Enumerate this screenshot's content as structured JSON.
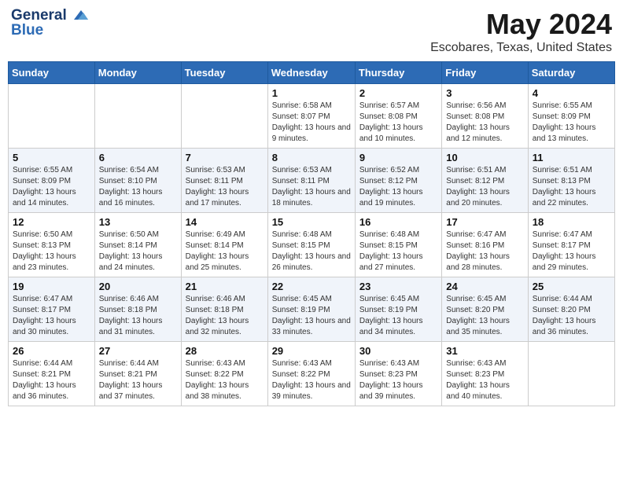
{
  "header": {
    "logo_line1": "General",
    "logo_line2": "Blue",
    "month": "May 2024",
    "location": "Escobares, Texas, United States"
  },
  "weekdays": [
    "Sunday",
    "Monday",
    "Tuesday",
    "Wednesday",
    "Thursday",
    "Friday",
    "Saturday"
  ],
  "weeks": [
    [
      {
        "day": "",
        "sunrise": "",
        "sunset": "",
        "daylight": ""
      },
      {
        "day": "",
        "sunrise": "",
        "sunset": "",
        "daylight": ""
      },
      {
        "day": "",
        "sunrise": "",
        "sunset": "",
        "daylight": ""
      },
      {
        "day": "1",
        "sunrise": "Sunrise: 6:58 AM",
        "sunset": "Sunset: 8:07 PM",
        "daylight": "Daylight: 13 hours and 9 minutes."
      },
      {
        "day": "2",
        "sunrise": "Sunrise: 6:57 AM",
        "sunset": "Sunset: 8:08 PM",
        "daylight": "Daylight: 13 hours and 10 minutes."
      },
      {
        "day": "3",
        "sunrise": "Sunrise: 6:56 AM",
        "sunset": "Sunset: 8:08 PM",
        "daylight": "Daylight: 13 hours and 12 minutes."
      },
      {
        "day": "4",
        "sunrise": "Sunrise: 6:55 AM",
        "sunset": "Sunset: 8:09 PM",
        "daylight": "Daylight: 13 hours and 13 minutes."
      }
    ],
    [
      {
        "day": "5",
        "sunrise": "Sunrise: 6:55 AM",
        "sunset": "Sunset: 8:09 PM",
        "daylight": "Daylight: 13 hours and 14 minutes."
      },
      {
        "day": "6",
        "sunrise": "Sunrise: 6:54 AM",
        "sunset": "Sunset: 8:10 PM",
        "daylight": "Daylight: 13 hours and 16 minutes."
      },
      {
        "day": "7",
        "sunrise": "Sunrise: 6:53 AM",
        "sunset": "Sunset: 8:11 PM",
        "daylight": "Daylight: 13 hours and 17 minutes."
      },
      {
        "day": "8",
        "sunrise": "Sunrise: 6:53 AM",
        "sunset": "Sunset: 8:11 PM",
        "daylight": "Daylight: 13 hours and 18 minutes."
      },
      {
        "day": "9",
        "sunrise": "Sunrise: 6:52 AM",
        "sunset": "Sunset: 8:12 PM",
        "daylight": "Daylight: 13 hours and 19 minutes."
      },
      {
        "day": "10",
        "sunrise": "Sunrise: 6:51 AM",
        "sunset": "Sunset: 8:12 PM",
        "daylight": "Daylight: 13 hours and 20 minutes."
      },
      {
        "day": "11",
        "sunrise": "Sunrise: 6:51 AM",
        "sunset": "Sunset: 8:13 PM",
        "daylight": "Daylight: 13 hours and 22 minutes."
      }
    ],
    [
      {
        "day": "12",
        "sunrise": "Sunrise: 6:50 AM",
        "sunset": "Sunset: 8:13 PM",
        "daylight": "Daylight: 13 hours and 23 minutes."
      },
      {
        "day": "13",
        "sunrise": "Sunrise: 6:50 AM",
        "sunset": "Sunset: 8:14 PM",
        "daylight": "Daylight: 13 hours and 24 minutes."
      },
      {
        "day": "14",
        "sunrise": "Sunrise: 6:49 AM",
        "sunset": "Sunset: 8:14 PM",
        "daylight": "Daylight: 13 hours and 25 minutes."
      },
      {
        "day": "15",
        "sunrise": "Sunrise: 6:48 AM",
        "sunset": "Sunset: 8:15 PM",
        "daylight": "Daylight: 13 hours and 26 minutes."
      },
      {
        "day": "16",
        "sunrise": "Sunrise: 6:48 AM",
        "sunset": "Sunset: 8:15 PM",
        "daylight": "Daylight: 13 hours and 27 minutes."
      },
      {
        "day": "17",
        "sunrise": "Sunrise: 6:47 AM",
        "sunset": "Sunset: 8:16 PM",
        "daylight": "Daylight: 13 hours and 28 minutes."
      },
      {
        "day": "18",
        "sunrise": "Sunrise: 6:47 AM",
        "sunset": "Sunset: 8:17 PM",
        "daylight": "Daylight: 13 hours and 29 minutes."
      }
    ],
    [
      {
        "day": "19",
        "sunrise": "Sunrise: 6:47 AM",
        "sunset": "Sunset: 8:17 PM",
        "daylight": "Daylight: 13 hours and 30 minutes."
      },
      {
        "day": "20",
        "sunrise": "Sunrise: 6:46 AM",
        "sunset": "Sunset: 8:18 PM",
        "daylight": "Daylight: 13 hours and 31 minutes."
      },
      {
        "day": "21",
        "sunrise": "Sunrise: 6:46 AM",
        "sunset": "Sunset: 8:18 PM",
        "daylight": "Daylight: 13 hours and 32 minutes."
      },
      {
        "day": "22",
        "sunrise": "Sunrise: 6:45 AM",
        "sunset": "Sunset: 8:19 PM",
        "daylight": "Daylight: 13 hours and 33 minutes."
      },
      {
        "day": "23",
        "sunrise": "Sunrise: 6:45 AM",
        "sunset": "Sunset: 8:19 PM",
        "daylight": "Daylight: 13 hours and 34 minutes."
      },
      {
        "day": "24",
        "sunrise": "Sunrise: 6:45 AM",
        "sunset": "Sunset: 8:20 PM",
        "daylight": "Daylight: 13 hours and 35 minutes."
      },
      {
        "day": "25",
        "sunrise": "Sunrise: 6:44 AM",
        "sunset": "Sunset: 8:20 PM",
        "daylight": "Daylight: 13 hours and 36 minutes."
      }
    ],
    [
      {
        "day": "26",
        "sunrise": "Sunrise: 6:44 AM",
        "sunset": "Sunset: 8:21 PM",
        "daylight": "Daylight: 13 hours and 36 minutes."
      },
      {
        "day": "27",
        "sunrise": "Sunrise: 6:44 AM",
        "sunset": "Sunset: 8:21 PM",
        "daylight": "Daylight: 13 hours and 37 minutes."
      },
      {
        "day": "28",
        "sunrise": "Sunrise: 6:43 AM",
        "sunset": "Sunset: 8:22 PM",
        "daylight": "Daylight: 13 hours and 38 minutes."
      },
      {
        "day": "29",
        "sunrise": "Sunrise: 6:43 AM",
        "sunset": "Sunset: 8:22 PM",
        "daylight": "Daylight: 13 hours and 39 minutes."
      },
      {
        "day": "30",
        "sunrise": "Sunrise: 6:43 AM",
        "sunset": "Sunset: 8:23 PM",
        "daylight": "Daylight: 13 hours and 39 minutes."
      },
      {
        "day": "31",
        "sunrise": "Sunrise: 6:43 AM",
        "sunset": "Sunset: 8:23 PM",
        "daylight": "Daylight: 13 hours and 40 minutes."
      },
      {
        "day": "",
        "sunrise": "",
        "sunset": "",
        "daylight": ""
      }
    ]
  ]
}
